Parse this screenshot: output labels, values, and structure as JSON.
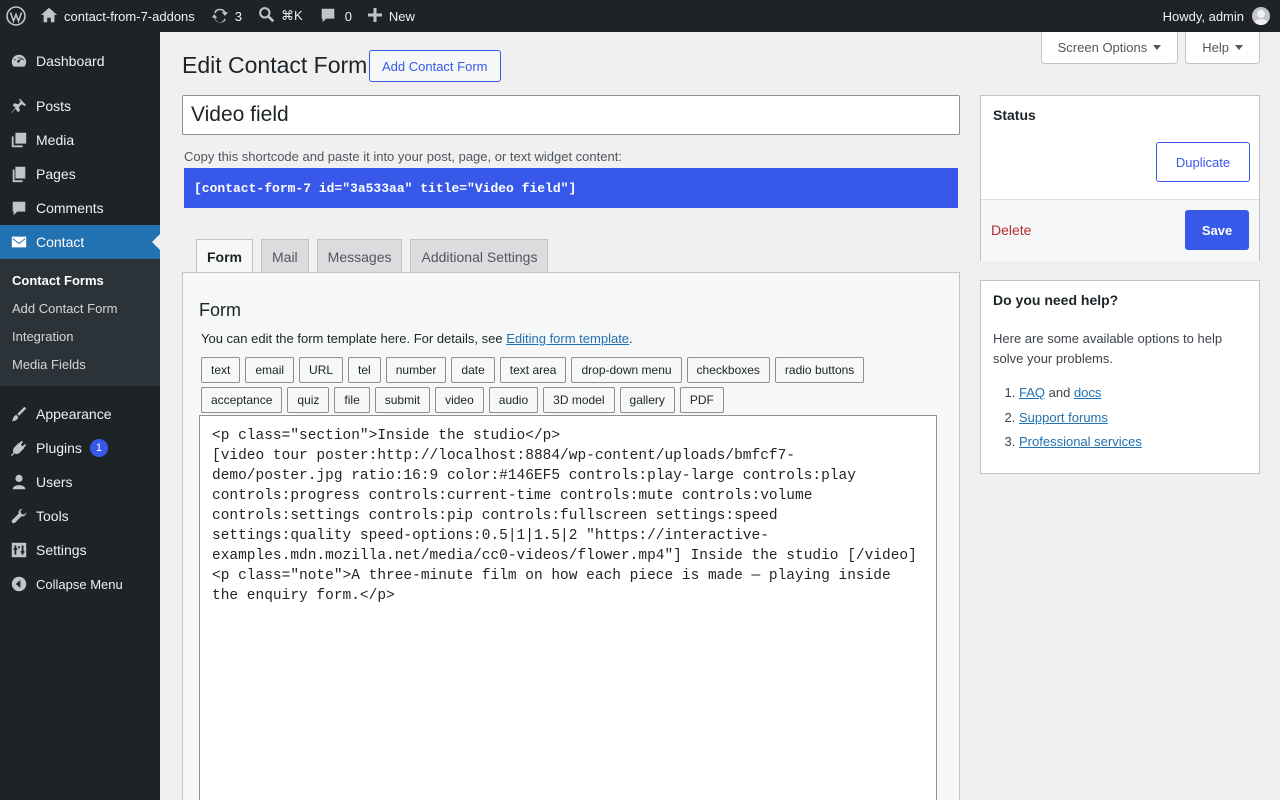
{
  "admin_bar": {
    "site_name": "contact-from-7-addons",
    "updates_count": "3",
    "search_shortcut": "⌘K",
    "comments_count": "0",
    "new_label": "New",
    "greeting": "Howdy, admin"
  },
  "sidebar": {
    "dashboard": "Dashboard",
    "posts": "Posts",
    "media": "Media",
    "pages": "Pages",
    "comments": "Comments",
    "contact": "Contact",
    "submenu": [
      "Contact Forms",
      "Add Contact Form",
      "Integration",
      "Media Fields"
    ],
    "appearance": "Appearance",
    "plugins": "Plugins",
    "plugins_badge": "1",
    "users": "Users",
    "tools": "Tools",
    "settings": "Settings",
    "collapse": "Collapse Menu"
  },
  "screen_meta": {
    "screen_options": "Screen Options",
    "help": "Help"
  },
  "page": {
    "title": "Edit Contact Form",
    "add_new": "Add Contact Form",
    "form_title": "Video field",
    "shortcode_label": "Copy this shortcode and paste it into your post, page, or text widget content:",
    "shortcode": "[contact-form-7 id=\"3a533aa\" title=\"Video field\"]"
  },
  "tabs": [
    "Form",
    "Mail",
    "Messages",
    "Additional Settings"
  ],
  "form_panel": {
    "heading": "Form",
    "desc_prefix": "You can edit the form template here. For details, see ",
    "desc_link": "Editing form template",
    "desc_suffix": ".",
    "tag_buttons_row1": [
      "text",
      "email",
      "URL",
      "tel",
      "number",
      "date",
      "text area",
      "drop-down menu",
      "checkboxes",
      "radio buttons"
    ],
    "tag_buttons_row2": [
      "acceptance",
      "quiz",
      "file",
      "submit",
      "video",
      "audio",
      "3D model",
      "gallery",
      "PDF"
    ],
    "template_code": "<p class=\"section\">Inside the studio</p>\n[video tour poster:http://localhost:8884/wp-content/uploads/bmfcf7-demo/poster.jpg ratio:16:9 color:#146EF5 controls:play-large controls:play controls:progress controls:current-time controls:mute controls:volume controls:settings controls:pip controls:fullscreen settings:speed settings:quality speed-options:0.5|1|1.5|2 \"https://interactive-examples.mdn.mozilla.net/media/cc0-videos/flower.mp4\"] Inside the studio [/video]\n<p class=\"note\">A three-minute film on how each piece is made — playing inside the enquiry form.</p>"
  },
  "status_box": {
    "heading": "Status",
    "duplicate": "Duplicate",
    "delete": "Delete",
    "save": "Save"
  },
  "help_box": {
    "heading": "Do you need help?",
    "text": "Here are some available options to help solve your problems.",
    "faq": "FAQ",
    "and": " and ",
    "docs": "docs",
    "support": "Support forums",
    "professional": "Professional services"
  },
  "colors": {
    "accent": "#3858e9",
    "admin_bar": "#1d2327",
    "delete": "#b32d2e"
  }
}
